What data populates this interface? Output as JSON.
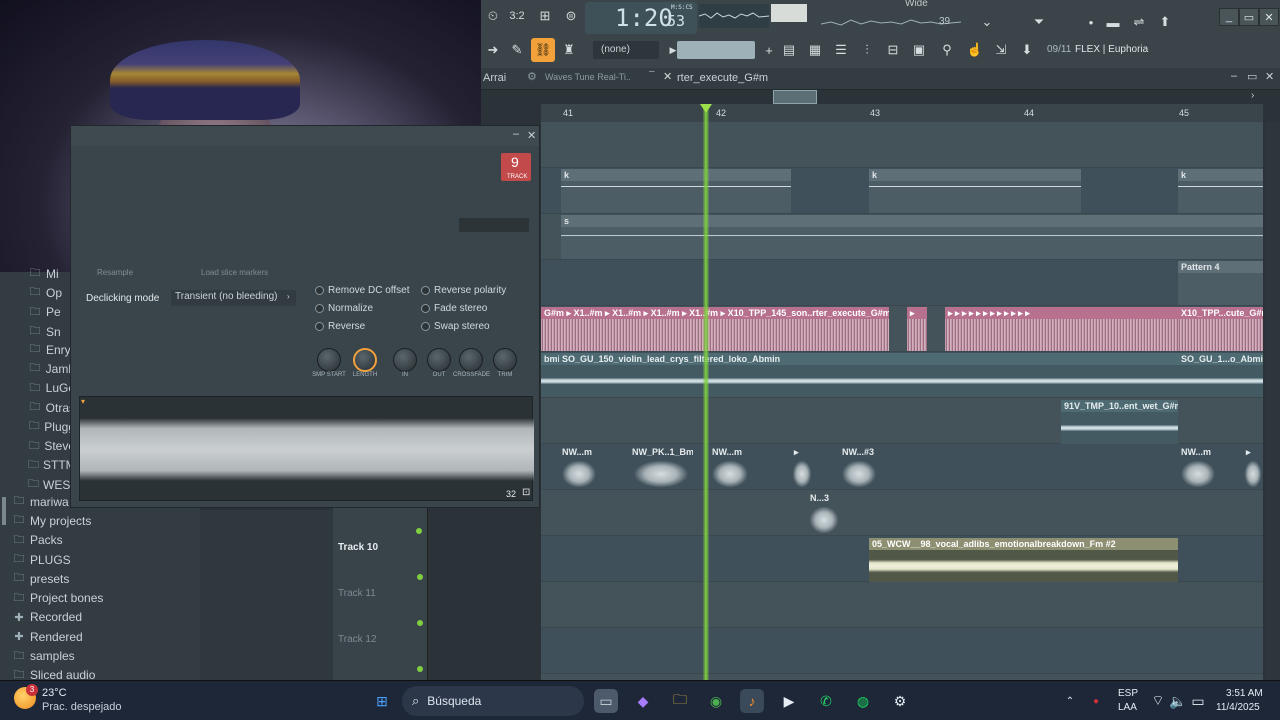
{
  "app": {
    "time_display": "1:20",
    "time_frames": "53",
    "time_unit": "M:S:CS",
    "tempo_lcd": "39",
    "pattern_selector": "(none)",
    "preset_counter": "09/11",
    "preset_name": "FLEX | Euphoria",
    "top_label": "Wide",
    "arrangement_tab": "Arrai",
    "plugin_tab": "Waves Tune Real-Ti..",
    "playlist_title": "rter_execute_G#m"
  },
  "ruler": {
    "bars": [
      "41",
      "42",
      "43",
      "44",
      "45"
    ]
  },
  "sampler": {
    "track_number": "9",
    "track_label": "TRACK",
    "resample_label": "Resample",
    "load_slice_label": "Load slice markers",
    "declicking_label": "Declicking mode",
    "declicking_value": "Transient (no bleeding)",
    "options_left": [
      "Remove DC offset",
      "Normalize",
      "Reverse"
    ],
    "options_right": [
      "Reverse polarity",
      "Fade stereo",
      "Swap stereo"
    ],
    "knobs": [
      "SMP START",
      "LENGTH",
      "IN",
      "OUT",
      "CROSSFADE",
      "TRIM"
    ],
    "wave_counter": "32"
  },
  "clips": {
    "pattern_k1": "k",
    "pattern_k2": "k",
    "pattern_k3": "k",
    "pattern_s": "s",
    "pattern_4": "Pattern 4",
    "pink_main": "G#m ▸ X1..#m ▸ X1..#m ▸ X1..#m ▸ X1..#m ▸ X10_TPP_145_son..rter_execute_G#m ▸",
    "pink_right": "X10_TPP...cute_G#m",
    "violin_left": "bmin",
    "violin_main": "SO_GU_150_violin_lead_crys_filtered_loko_Abmin",
    "violin_right": "SO_GU_1...o_Abmin",
    "wet": "91V_TMP_10..ent_wet_G#m",
    "nw1": "NW...m",
    "nw2": "NW_PK..1_Bm",
    "nw3": "NW...m",
    "nw4": "NW...#3",
    "nw5": "NW...m",
    "n3": "N...3",
    "vocal": "05_WCW__98_vocal_adlibs_emotionalbreakdown_Fm #2"
  },
  "tracks": [
    "Track 10",
    "Track 11",
    "Track 12"
  ],
  "browser": {
    "top_items": [
      "Mi",
      "Op",
      "Pe",
      "Sn",
      "Enry",
      "Jamb",
      "LuGe",
      "Otras",
      "Plugg",
      "Steve",
      "STTM",
      "WEST"
    ],
    "bottom_items": [
      {
        "icon": "folder-icon",
        "label": "mariwa"
      },
      {
        "icon": "folder-icon",
        "label": "My projects"
      },
      {
        "icon": "folder-icon",
        "label": "Packs"
      },
      {
        "icon": "folder-icon",
        "label": "PLUGS"
      },
      {
        "icon": "folder-icon",
        "label": "presets"
      },
      {
        "icon": "folder-icon",
        "label": "Project bones"
      },
      {
        "icon": "recorded-icon",
        "label": "Recorded"
      },
      {
        "icon": "rendered-icon",
        "label": "Rendered"
      },
      {
        "icon": "folder-icon",
        "label": "samples"
      },
      {
        "icon": "folder-icon",
        "label": "Sliced audio"
      }
    ]
  },
  "taskbar": {
    "weather_temp": "23°C",
    "weather_desc": "Prac. despejado",
    "weather_badge": "3",
    "search_placeholder": "Búsqueda",
    "lang_top": "ESP",
    "lang_bottom": "LAA",
    "clock_time": "3:51 AM",
    "clock_date": "11/4/2025"
  }
}
